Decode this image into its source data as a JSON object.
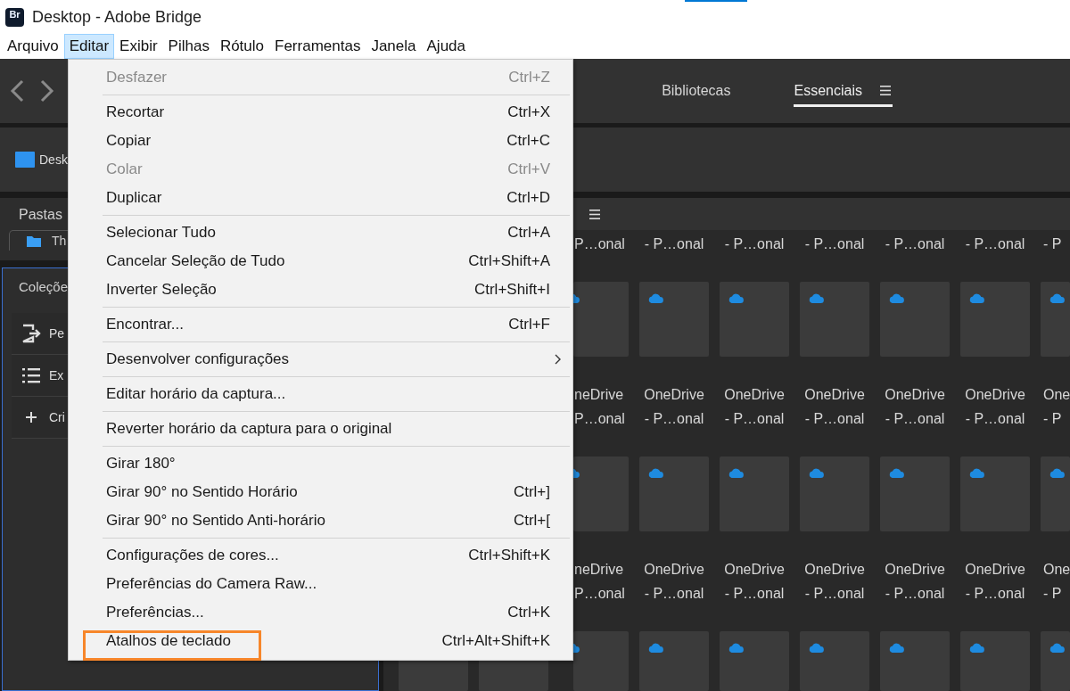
{
  "window": {
    "logo": "Br",
    "title": "Desktop - Adobe Bridge"
  },
  "menu_bar": [
    {
      "label": "Arquivo",
      "selected": false
    },
    {
      "label": "Editar",
      "selected": true
    },
    {
      "label": "Exibir",
      "selected": false
    },
    {
      "label": "Pilhas",
      "selected": false
    },
    {
      "label": "Rótulo",
      "selected": false
    },
    {
      "label": "Ferramentas",
      "selected": false
    },
    {
      "label": "Janela",
      "selected": false
    },
    {
      "label": "Ajuda",
      "selected": false
    }
  ],
  "toolbar": {
    "tabs": [
      {
        "label": "Bibliotecas",
        "selected": false
      },
      {
        "label": "Essenciais",
        "selected": true
      }
    ]
  },
  "path_bar": {
    "location": "Desk"
  },
  "folders_panel": {
    "title": "Pastas",
    "items": [
      {
        "label": "Th"
      }
    ]
  },
  "collections_panel": {
    "title": "Coleçõe",
    "items": [
      {
        "label": "Pe",
        "kind": "export"
      },
      {
        "label": "Ex",
        "kind": "list"
      },
      {
        "label": "Cri",
        "kind": "add"
      }
    ]
  },
  "content": {
    "rows": [
      {
        "kind": "captions",
        "cells": [
          {
            "kind": "empty"
          },
          {
            "kind": "empty"
          },
          {
            "kind": "cut-left",
            "lines": [
              "P…onal"
            ]
          },
          {
            "kind": "full",
            "lines": [
              "- P…onal"
            ]
          },
          {
            "kind": "full",
            "lines": [
              "- P…onal"
            ]
          },
          {
            "kind": "full",
            "lines": [
              "- P…onal"
            ]
          },
          {
            "kind": "full",
            "lines": [
              "- P…onal"
            ]
          },
          {
            "kind": "full",
            "lines": [
              "- P…onal"
            ]
          },
          {
            "kind": "cut-right",
            "lines": [
              "- P"
            ]
          }
        ]
      },
      {
        "kind": "tiles",
        "cells": [
          {
            "kind": "empty"
          },
          {
            "kind": "empty"
          },
          {
            "kind": "cut-left",
            "cloud": true
          },
          {
            "kind": "full",
            "cloud": true
          },
          {
            "kind": "full",
            "cloud": true
          },
          {
            "kind": "full",
            "cloud": true
          },
          {
            "kind": "full",
            "cloud": true
          },
          {
            "kind": "full",
            "cloud": true
          },
          {
            "kind": "cut-right",
            "cloud": true
          }
        ]
      },
      {
        "kind": "captions",
        "cells": [
          {
            "kind": "empty"
          },
          {
            "kind": "empty"
          },
          {
            "kind": "cut-left",
            "lines": [
              "neDrive",
              "P…onal"
            ]
          },
          {
            "kind": "full",
            "lines": [
              "OneDrive",
              "- P…onal"
            ]
          },
          {
            "kind": "full",
            "lines": [
              "OneDrive",
              "- P…onal"
            ]
          },
          {
            "kind": "full",
            "lines": [
              "OneDrive",
              "- P…onal"
            ]
          },
          {
            "kind": "full",
            "lines": [
              "OneDrive",
              "- P…onal"
            ]
          },
          {
            "kind": "full",
            "lines": [
              "OneDrive",
              "- P…onal"
            ]
          },
          {
            "kind": "cut-right",
            "lines": [
              "One",
              "- P"
            ]
          }
        ]
      },
      {
        "kind": "tiles",
        "cells": [
          {
            "kind": "empty"
          },
          {
            "kind": "empty"
          },
          {
            "kind": "cut-left",
            "cloud": true
          },
          {
            "kind": "full",
            "cloud": true
          },
          {
            "kind": "full",
            "cloud": true
          },
          {
            "kind": "full",
            "cloud": true
          },
          {
            "kind": "full",
            "cloud": true
          },
          {
            "kind": "full",
            "cloud": true
          },
          {
            "kind": "cut-right",
            "cloud": true
          }
        ]
      },
      {
        "kind": "captions",
        "cells": [
          {
            "kind": "empty"
          },
          {
            "kind": "empty"
          },
          {
            "kind": "cut-left",
            "lines": [
              "neDrive",
              "P…onal"
            ]
          },
          {
            "kind": "full",
            "lines": [
              "OneDrive",
              "- P…onal"
            ]
          },
          {
            "kind": "full",
            "lines": [
              "OneDrive",
              "- P…onal"
            ]
          },
          {
            "kind": "full",
            "lines": [
              "OneDrive",
              "- P…onal"
            ]
          },
          {
            "kind": "full",
            "lines": [
              "OneDrive",
              "- P…onal"
            ]
          },
          {
            "kind": "full",
            "lines": [
              "OneDrive",
              "- P…onal"
            ]
          },
          {
            "kind": "cut-right",
            "lines": [
              "One",
              "- P"
            ]
          }
        ]
      },
      {
        "kind": "tiles",
        "cells": [
          {
            "kind": "full"
          },
          {
            "kind": "full"
          },
          {
            "kind": "cut-left",
            "cloud": true
          },
          {
            "kind": "full",
            "cloud": true
          },
          {
            "kind": "full",
            "cloud": true
          },
          {
            "kind": "full",
            "cloud": true
          },
          {
            "kind": "full",
            "cloud": true
          },
          {
            "kind": "full",
            "cloud": true
          },
          {
            "kind": "cut-right",
            "cloud": true
          }
        ]
      }
    ]
  },
  "edit_menu": {
    "items": [
      {
        "kind": "command",
        "label": "Desfazer",
        "shortcut": "Ctrl+Z",
        "disabled": true,
        "highlighted": false
      },
      {
        "kind": "separator"
      },
      {
        "kind": "command",
        "label": "Recortar",
        "shortcut": "Ctrl+X",
        "disabled": false,
        "highlighted": false
      },
      {
        "kind": "command",
        "label": "Copiar",
        "shortcut": "Ctrl+C",
        "disabled": false,
        "highlighted": false
      },
      {
        "kind": "command",
        "label": "Colar",
        "shortcut": "Ctrl+V",
        "disabled": true,
        "highlighted": false
      },
      {
        "kind": "command",
        "label": "Duplicar",
        "shortcut": "Ctrl+D",
        "disabled": false,
        "highlighted": false
      },
      {
        "kind": "separator"
      },
      {
        "kind": "command",
        "label": "Selecionar Tudo",
        "shortcut": "Ctrl+A",
        "disabled": false,
        "highlighted": false
      },
      {
        "kind": "command",
        "label": "Cancelar Seleção de Tudo",
        "shortcut": "Ctrl+Shift+A",
        "disabled": false,
        "highlighted": false
      },
      {
        "kind": "command",
        "label": "Inverter Seleção",
        "shortcut": "Ctrl+Shift+I",
        "disabled": false,
        "highlighted": false
      },
      {
        "kind": "separator"
      },
      {
        "kind": "command",
        "label": "Encontrar...",
        "shortcut": "Ctrl+F",
        "disabled": false,
        "highlighted": false
      },
      {
        "kind": "separator"
      },
      {
        "kind": "submenu",
        "label": "Desenvolver configurações",
        "disabled": false,
        "highlighted": false
      },
      {
        "kind": "separator"
      },
      {
        "kind": "command",
        "label": "Editar horário da captura...",
        "disabled": false,
        "highlighted": false
      },
      {
        "kind": "separator"
      },
      {
        "kind": "command",
        "label": "Reverter horário da captura para o original",
        "disabled": false,
        "highlighted": false
      },
      {
        "kind": "separator"
      },
      {
        "kind": "command",
        "label": "Girar 180°",
        "disabled": false,
        "highlighted": false
      },
      {
        "kind": "command",
        "label": "Girar 90° no Sentido Horário",
        "shortcut": "Ctrl+]",
        "disabled": false,
        "highlighted": false
      },
      {
        "kind": "command",
        "label": "Girar 90° no Sentido Anti-horário",
        "shortcut": "Ctrl+[",
        "disabled": false,
        "highlighted": false
      },
      {
        "kind": "separator"
      },
      {
        "kind": "command",
        "label": "Configurações de cores...",
        "shortcut": "Ctrl+Shift+K",
        "disabled": false,
        "highlighted": false
      },
      {
        "kind": "command",
        "label": "Preferências do Camera Raw...",
        "disabled": false,
        "highlighted": false
      },
      {
        "kind": "command",
        "label": "Preferências...",
        "shortcut": "Ctrl+K",
        "disabled": false,
        "highlighted": false
      },
      {
        "kind": "command",
        "label": "Atalhos de teclado",
        "shortcut": "Ctrl+Alt+Shift+K",
        "disabled": false,
        "highlighted": true
      }
    ]
  }
}
